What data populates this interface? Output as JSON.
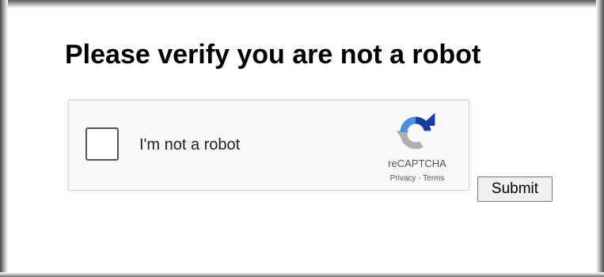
{
  "page": {
    "title": "Please verify you are not a robot"
  },
  "recaptcha": {
    "checkbox_label": "I'm not a robot",
    "checked": false,
    "brand": "reCAPTCHA",
    "privacy_link": "Privacy",
    "separator": " - ",
    "terms_link": "Terms",
    "logo_icon": "recaptcha-logo-icon",
    "colors": {
      "blue": "#1c3aa9",
      "light_blue": "#4a90e2",
      "gray": "#b0b0b0"
    }
  },
  "form": {
    "submit_label": "Submit"
  }
}
